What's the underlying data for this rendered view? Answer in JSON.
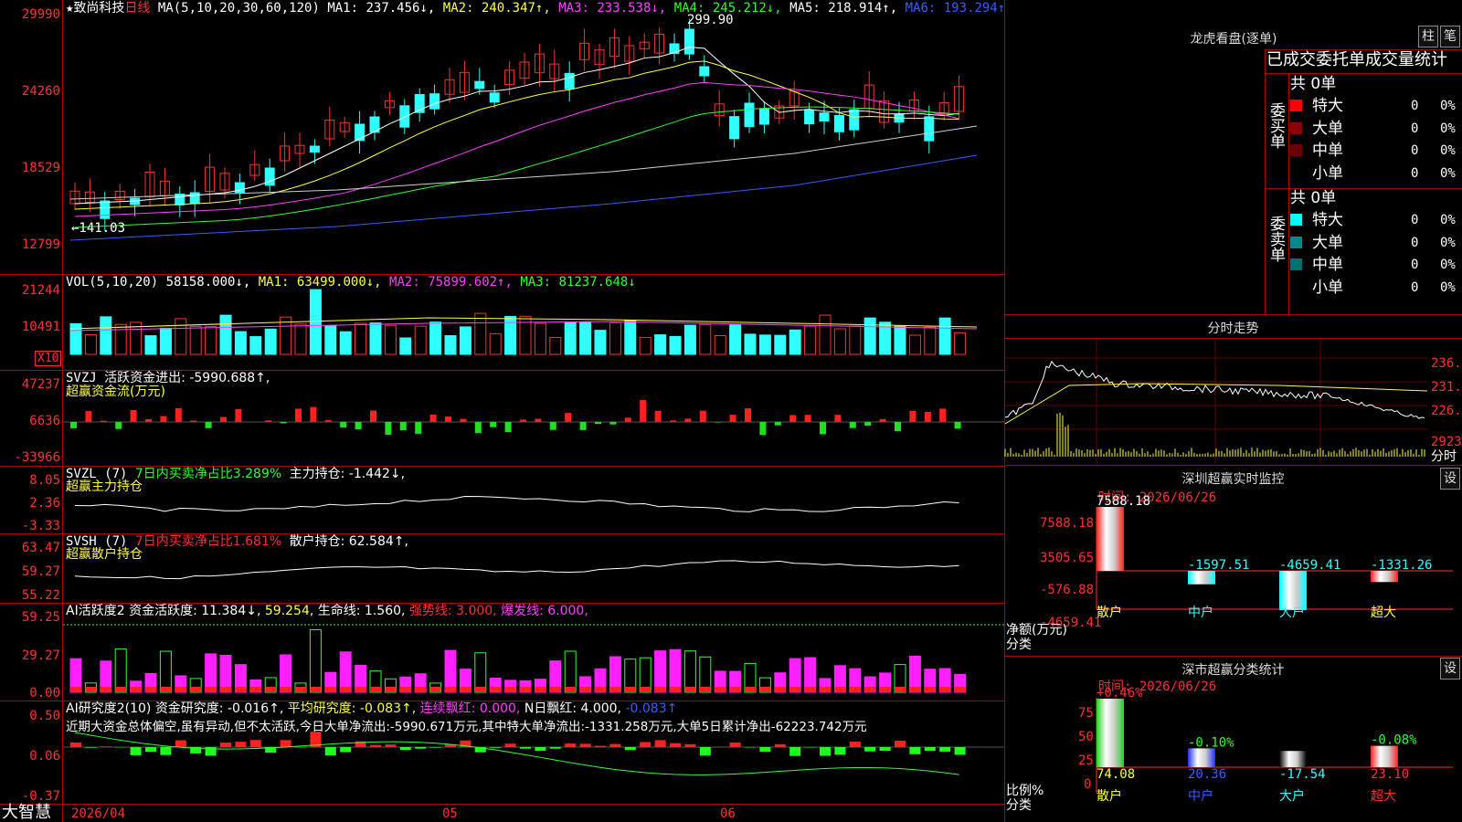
{
  "stock": {
    "star": "★",
    "name": "致尚科技",
    "period": "日线",
    "ma_params": "MA(5,10,20,30,60,120)",
    "ma1": "MA1: 237.456↓,",
    "ma2": "MA2: 240.347↑,",
    "ma3": "MA3: 233.538↓,",
    "ma4": "MA4: 245.212↓,",
    "ma5": "MA5: 218.914↑,",
    "ma6": "MA6: 193.294↑"
  },
  "price_axis": [
    "29990",
    "24260",
    "18529",
    "12799"
  ],
  "price_annotations": {
    "high": "299.90",
    "low": "←141.03"
  },
  "vol": {
    "header": "VOL(5,10,20)",
    "value": "58158.000↓,",
    "ma1": "MA1: 63499.000↓,",
    "ma2": "MA2: 75899.602↑,",
    "ma3": "MA3: 81237.648↓",
    "axis": [
      "21244",
      "10491"
    ],
    "unit": "X10"
  },
  "svzj": {
    "header": "SVZJ",
    "label": "活跃资金进出: -5990.688↑,",
    "sub": "超赢资金流(万元)",
    "axis": [
      "47237",
      "6636",
      "-33966"
    ]
  },
  "svzl": {
    "header": "SVZL (7)",
    "label1": "7日内买卖净占比3.289%",
    "label2": "主力持仓: -1.442↓,",
    "sub": "超赢主力持仓",
    "axis": [
      "8.05",
      "2.36",
      "-3.33"
    ]
  },
  "svsh": {
    "header": "SVSH (7)",
    "label1": "7日内买卖净占比1.681%",
    "label2": "散户持仓: 62.584↑,",
    "sub": "超赢散户持仓",
    "axis": [
      "63.47",
      "59.27",
      "55.22"
    ]
  },
  "ai1": {
    "header": "AI活跃度2",
    "l1": "资金活跃度: 11.384↓,",
    "l2": "59.254,",
    "l3": "生命线: 1.560,",
    "l4": "强势线: 3.000,",
    "l5": "爆发线: 6.000,",
    "axis": [
      "59.25",
      "29.27",
      "0.00"
    ]
  },
  "ai2": {
    "header": "AI研究度2(10)",
    "l1": "资金研究度: -0.016↑,",
    "l2": "平均研究度: -0.083↑,",
    "l3": "连续飘红: 0.000,",
    "l4": "N日飘红: 4.000,",
    "l5": "-0.083↑",
    "comment": "近期大资金总体偏空,虽有异动,但不太活跃,今日大单净流出:-5990.671万元,其中特大单净流出:-1331.258万元,大单5日累计净出-62223.742万元",
    "axis": [
      "0.50",
      "0.06",
      "-0.37"
    ]
  },
  "date_axis": [
    "2026/04",
    "05",
    "06"
  ],
  "bottom_logo": "大智慧",
  "lhb": {
    "title": "龙虎看盘(逐单)",
    "btn1": "柱",
    "btn2": "笔",
    "tabs": "已成交委托单成交量统计",
    "buy_total": "共 0单",
    "sell_total": "共 0单",
    "buy_side": "委买单",
    "sell_side": "委卖单",
    "buy_rows": [
      {
        "name": "特大",
        "val": "0",
        "pct": "0%",
        "color": "#ff0000"
      },
      {
        "name": "大单",
        "val": "0",
        "pct": "0%",
        "color": "#8b0000"
      },
      {
        "name": "中单",
        "val": "0",
        "pct": "0%",
        "color": "#6a0000"
      },
      {
        "name": "小单",
        "val": "0",
        "pct": "0%",
        "color": "#000000"
      }
    ],
    "sell_rows": [
      {
        "name": "特大",
        "val": "0",
        "pct": "0%",
        "color": "#00ffff"
      },
      {
        "name": "大单",
        "val": "0",
        "pct": "0%",
        "color": "#008b8b"
      },
      {
        "name": "中单",
        "val": "0",
        "pct": "0%",
        "color": "#007070"
      },
      {
        "name": "小单",
        "val": "0",
        "pct": "0%",
        "color": "#000000"
      }
    ]
  },
  "intraday": {
    "title": "分时走势",
    "axis": [
      "236.6",
      "231.4",
      "226.2",
      "2923",
      "分时"
    ]
  },
  "monitor": {
    "title": "深圳超赢实时监控",
    "set_btn": "设",
    "time": "时间: 2026/06/26",
    "axis": [
      "7588.18",
      "3505.65",
      "-576.88",
      "-4659.41"
    ],
    "ylabel1": "净额(万元)",
    "ylabel2": "分类",
    "chart_data": {
      "type": "bar",
      "categories": [
        "散户",
        "中户",
        "大户",
        "超大"
      ],
      "values": [
        7588.18,
        -1597.51,
        -4659.41,
        -1331.26
      ],
      "value_labels": [
        "7588.18",
        "-1597.51",
        "-4659.41",
        "-1331.26"
      ],
      "ylim": [
        -4659.41,
        7588.18
      ]
    }
  },
  "classify": {
    "title": "深市超赢分类统计",
    "set_btn": "设",
    "time": "时间: 2026/06/26",
    "axis": [
      "75",
      "50",
      "25",
      "0"
    ],
    "ylabel1": "比例%",
    "ylabel2": "分类",
    "chart_data": {
      "type": "bar",
      "categories": [
        "散户",
        "中户",
        "大户",
        "超大"
      ],
      "values": [
        74.08,
        20.36,
        -17.54,
        23.1
      ],
      "changes": [
        "+0.46%",
        "-0.10%",
        "",
        "-0.08%"
      ],
      "value_labels": [
        "74.08",
        "20.36",
        "-17.54",
        "23.10"
      ],
      "ylim": [
        0,
        75
      ]
    }
  }
}
